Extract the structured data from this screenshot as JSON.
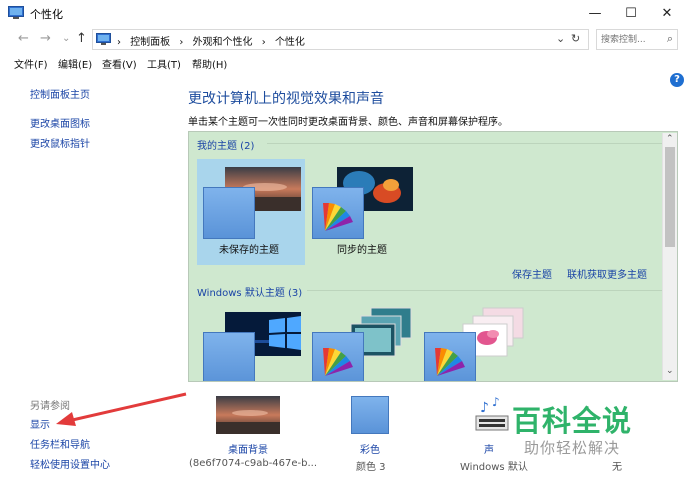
{
  "window": {
    "title": "个性化",
    "minimize_glyph": "—",
    "maximize_glyph": "☐",
    "close_glyph": "✕"
  },
  "navigation": {
    "back_glyph": "←",
    "forward_glyph": "→",
    "recent_glyph": "⌄",
    "up_glyph": "↑",
    "breadcrumbs": [
      "控制面板",
      "外观和个性化",
      "个性化"
    ],
    "separator": "›",
    "dropdown_glyph": "⌄",
    "refresh_glyph": "↻",
    "search_placeholder": "搜索控制...",
    "search_icon_glyph": "⌕"
  },
  "menu": [
    "文件(F)",
    "编辑(E)",
    "查看(V)",
    "工具(T)",
    "帮助(H)"
  ],
  "sidebar": {
    "links": [
      "控制面板主页",
      "更改桌面图标",
      "更改鼠标指针"
    ],
    "see_also_title": "另请参阅",
    "see_also": [
      "显示",
      "任务栏和导航",
      "轻松使用设置中心"
    ]
  },
  "main": {
    "heading": "更改计算机上的视觉效果和声音",
    "subheading": "单击某个主题可一次性同时更改桌面背景、颜色、声音和屏幕保护程序。",
    "help_glyph": "?",
    "my_themes": {
      "title": "我的主题 (2)",
      "items": [
        "未保存的主题",
        "同步的主题"
      ],
      "save_link": "保存主题",
      "online_link": "联机获取更多主题"
    },
    "windows_themes": {
      "title": "Windows 默认主题 (3)"
    },
    "scroll_up_glyph": "⌃",
    "scroll_down_glyph": "⌄"
  },
  "bottom": {
    "items": [
      {
        "label": "桌面背景",
        "sub": "(8e6f7074-c9ab-467e-b..."
      },
      {
        "label": "彩色",
        "sub": "颜色 3"
      },
      {
        "label": "声",
        "sub": "Windows 默认"
      },
      {
        "label": "",
        "sub": "无"
      }
    ]
  },
  "watermark": {
    "main": "百科全说",
    "sub": "助你轻松解决"
  },
  "colors": {
    "accent": "#1a44a6",
    "theme_panel_bg": "#cfe8cf",
    "arrow_red": "#e23b3b",
    "watermark_green": "#2fb36a",
    "selected_theme_bg": "#a9d5ec"
  }
}
